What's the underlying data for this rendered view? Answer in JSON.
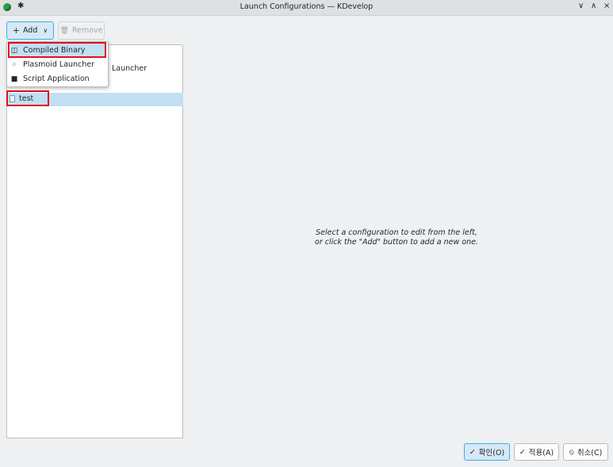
{
  "window": {
    "title": "Launch Configurations — KDevelop",
    "pin_icon": "pin-icon",
    "controls": {
      "minimize": "∨",
      "maximize": "∧",
      "close": "×"
    }
  },
  "toolbar": {
    "add_label": "Add",
    "add_icon": "+",
    "dropdown_icon": "∨",
    "remove_label": "Remove",
    "remove_icon": "trash-icon"
  },
  "dropdown_menu": {
    "items": [
      {
        "label": "Compiled Binary",
        "icon": "binary-icon",
        "glyph": "◫",
        "highlighted": true
      },
      {
        "label": "Plasmoid Launcher",
        "icon": "plasmoid-icon",
        "glyph": "⁘",
        "highlighted": false
      },
      {
        "label": "Script Application",
        "icon": "script-icon",
        "glyph": "■",
        "highlighted": false
      }
    ]
  },
  "config_list": {
    "obscured_text": "Launcher",
    "items": [
      {
        "label": "test",
        "icon": "file-icon",
        "selected": true
      }
    ]
  },
  "main": {
    "hint_line1": "Select a configuration to edit from the left,",
    "hint_line2": "or click the \"Add\" button to add a new one."
  },
  "buttons": {
    "ok": {
      "label": "확인(O)",
      "glyph": "✓"
    },
    "apply": {
      "label": "적용(A)",
      "glyph": "✓"
    },
    "cancel": {
      "label": "취소(C)",
      "glyph": "⦸"
    }
  },
  "colors": {
    "accent": "#3daee9",
    "highlight": "#c2dff3",
    "annotation": "#e0101b"
  }
}
